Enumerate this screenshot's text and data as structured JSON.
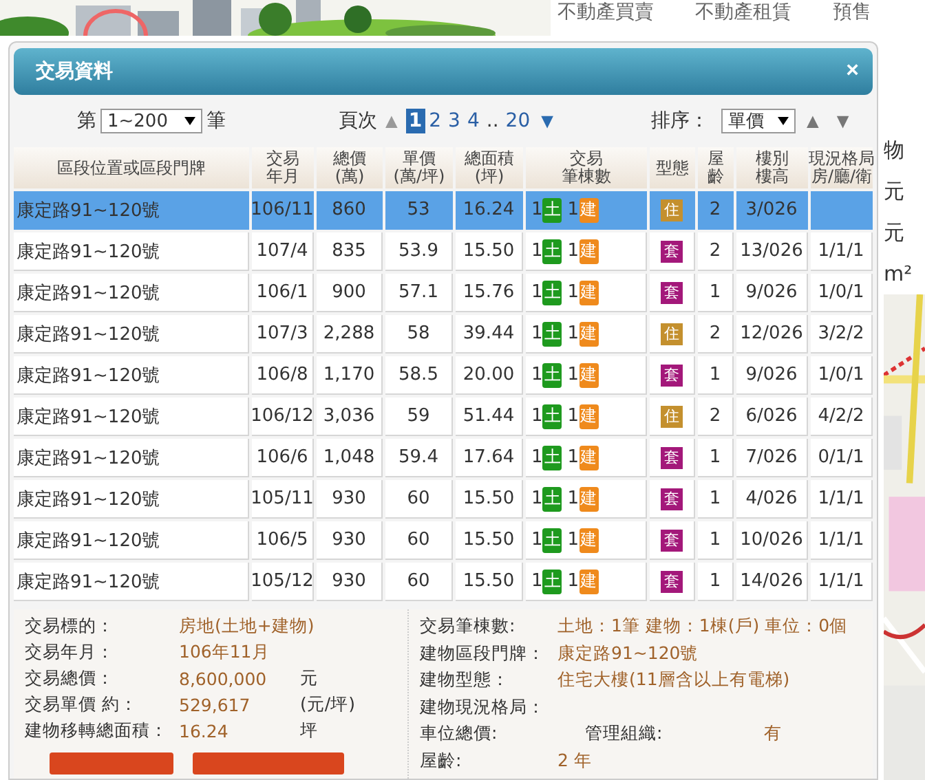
{
  "site_nav": [
    "不動產買賣",
    "不動產租賃",
    "預售"
  ],
  "background_labels": [
    "物",
    "元",
    "元",
    "m²"
  ],
  "dialog": {
    "title": "交易資料",
    "close": "×"
  },
  "range": {
    "prefix": "第",
    "value": "1~200",
    "suffix": "筆"
  },
  "pager": {
    "label": "頁次",
    "prev": "▲",
    "next": "▼",
    "pages": [
      {
        "label": "1",
        "kind": "page",
        "selected": true
      },
      {
        "label": "2",
        "kind": "page",
        "selected": false
      },
      {
        "label": "3",
        "kind": "page",
        "selected": false
      },
      {
        "label": "4",
        "kind": "page",
        "selected": false
      },
      {
        "label": "..",
        "kind": "gap"
      },
      {
        "label": "20",
        "kind": "page",
        "selected": false
      }
    ]
  },
  "sort": {
    "label": "排序：",
    "value": "單價",
    "up": "▲",
    "down": "▼"
  },
  "table": {
    "columns": [
      {
        "lines": [
          "區段位置或區段門牌"
        ]
      },
      {
        "lines": [
          "交易",
          "年月"
        ]
      },
      {
        "lines": [
          "總價",
          "(萬)"
        ]
      },
      {
        "lines": [
          "單價",
          "(萬/坪)"
        ]
      },
      {
        "lines": [
          "總面積",
          "(坪)"
        ]
      },
      {
        "lines": [
          "交易",
          "筆棟數"
        ]
      },
      {
        "lines": [
          "型態"
        ]
      },
      {
        "lines": [
          "屋",
          "齡"
        ]
      },
      {
        "lines": [
          "樓別",
          "樓高"
        ]
      },
      {
        "lines": [
          "現況格局",
          "房/廳/衛"
        ]
      }
    ],
    "rows": [
      {
        "address": "康定路91~120號",
        "date": "106/11",
        "total": "860",
        "unit_price": "53",
        "area": "16.24",
        "land": "1",
        "land_tag": "土",
        "building": "1",
        "building_tag": "建",
        "type": {
          "label": "住",
          "kind": "residence"
        },
        "age": "2",
        "floor": "3/026",
        "selected": true
      },
      {
        "address": "康定路91~120號",
        "date": "107/4",
        "total": "835",
        "unit_price": "53.9",
        "area": "15.50",
        "land": "1",
        "land_tag": "土",
        "building": "1",
        "building_tag": "建",
        "type": {
          "label": "套",
          "kind": "suite"
        },
        "age": "2",
        "floor": "13/026",
        "layout": "1/1/1",
        "selected": false
      },
      {
        "address": "康定路91~120號",
        "date": "106/1",
        "total": "900",
        "unit_price": "57.1",
        "area": "15.76",
        "land": "1",
        "land_tag": "土",
        "building": "1",
        "building_tag": "建",
        "type": {
          "label": "套",
          "kind": "suite"
        },
        "age": "1",
        "floor": "9/026",
        "layout": "1/0/1",
        "selected": false
      },
      {
        "address": "康定路91~120號",
        "date": "107/3",
        "total": "2,288",
        "unit_price": "58",
        "area": "39.44",
        "land": "1",
        "land_tag": "土",
        "building": "1",
        "building_tag": "建",
        "type": {
          "label": "住",
          "kind": "residence"
        },
        "age": "2",
        "floor": "12/026",
        "layout": "3/2/2",
        "selected": false
      },
      {
        "address": "康定路91~120號",
        "date": "106/8",
        "total": "1,170",
        "unit_price": "58.5",
        "area": "20.00",
        "land": "1",
        "land_tag": "土",
        "building": "1",
        "building_tag": "建",
        "type": {
          "label": "套",
          "kind": "suite"
        },
        "age": "1",
        "floor": "9/026",
        "layout": "1/0/1",
        "selected": false
      },
      {
        "address": "康定路91~120號",
        "date": "106/12",
        "total": "3,036",
        "unit_price": "59",
        "area": "51.44",
        "land": "1",
        "land_tag": "土",
        "building": "1",
        "building_tag": "建",
        "type": {
          "label": "住",
          "kind": "residence"
        },
        "age": "2",
        "floor": "6/026",
        "layout": "4/2/2",
        "selected": false
      },
      {
        "address": "康定路91~120號",
        "date": "106/6",
        "total": "1,048",
        "unit_price": "59.4",
        "area": "17.64",
        "land": "1",
        "land_tag": "土",
        "building": "1",
        "building_tag": "建",
        "type": {
          "label": "套",
          "kind": "suite"
        },
        "age": "1",
        "floor": "7/026",
        "layout": "0/1/1",
        "selected": false
      },
      {
        "address": "康定路91~120號",
        "date": "105/11",
        "total": "930",
        "unit_price": "60",
        "area": "15.50",
        "land": "1",
        "land_tag": "土",
        "building": "1",
        "building_tag": "建",
        "type": {
          "label": "套",
          "kind": "suite"
        },
        "age": "1",
        "floor": "4/026",
        "layout": "1/1/1",
        "selected": false
      },
      {
        "address": "康定路91~120號",
        "date": "106/5",
        "total": "930",
        "unit_price": "60",
        "area": "15.50",
        "land": "1",
        "land_tag": "土",
        "building": "1",
        "building_tag": "建",
        "type": {
          "label": "套",
          "kind": "suite"
        },
        "age": "1",
        "floor": "10/026",
        "layout": "1/1/1",
        "selected": false
      },
      {
        "address": "康定路91~120號",
        "date": "105/12",
        "total": "930",
        "unit_price": "60",
        "area": "15.50",
        "land": "1",
        "land_tag": "土",
        "building": "1",
        "building_tag": "建",
        "type": {
          "label": "套",
          "kind": "suite"
        },
        "age": "1",
        "floor": "14/026",
        "layout": "1/1/1",
        "selected": false
      }
    ]
  },
  "details": {
    "left": [
      {
        "label": "交易標的：",
        "value": "房地(土地+建物)"
      },
      {
        "label": "交易年月：",
        "value": "106年11月"
      },
      {
        "label": "交易總價：",
        "value": "8,600,000",
        "unit": "元"
      },
      {
        "label": "交易單價 約：",
        "value": "529,617",
        "unit": "(元/坪)"
      },
      {
        "label": "建物移轉總面積：",
        "value": "16.24",
        "unit": "坪"
      }
    ],
    "right": [
      {
        "label": "交易筆棟數:",
        "value": "土地：1筆 建物：1棟(戶) 車位：0個"
      },
      {
        "label": "建物區段門牌：",
        "value": "康定路91~120號"
      },
      {
        "label": "建物型態：",
        "value": "住宅大樓(11層含以上有電梯)"
      },
      {
        "label": "建物現況格局："
      },
      {
        "label": "車位總價:",
        "extra_label": "管理組織:",
        "extra_value": "有"
      },
      {
        "label": "屋齡:",
        "value": "2 年"
      }
    ]
  }
}
